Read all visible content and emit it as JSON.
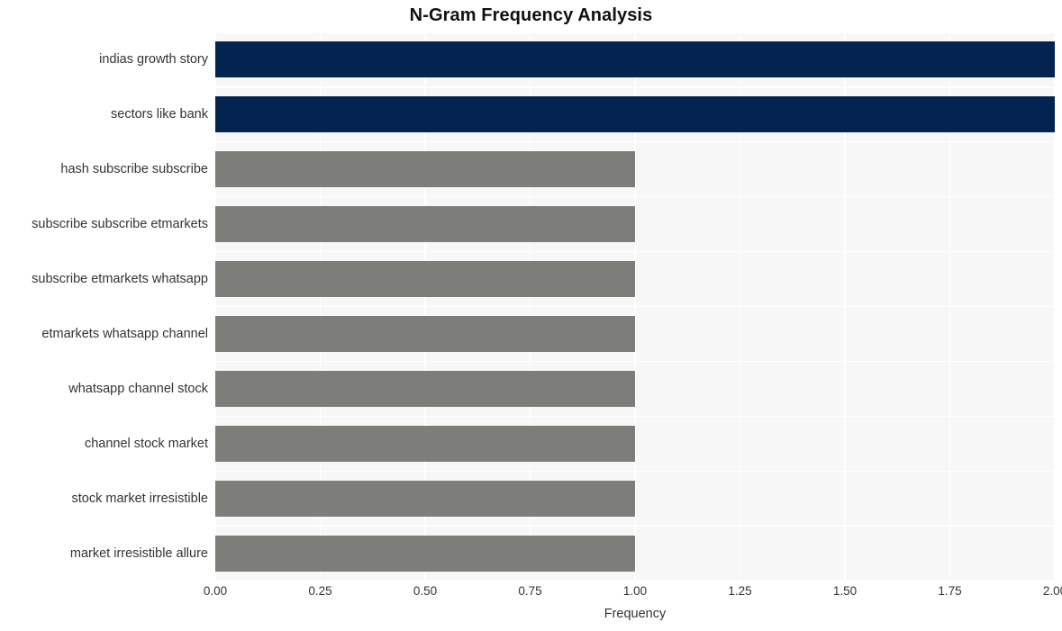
{
  "chart_data": {
    "type": "bar",
    "orientation": "horizontal",
    "title": "N-Gram Frequency Analysis",
    "xlabel": "Frequency",
    "ylabel": "",
    "xlim": [
      0,
      2
    ],
    "ylim": null,
    "grid": true,
    "legend": null,
    "categories": [
      "indias growth story",
      "sectors like bank",
      "hash subscribe subscribe",
      "subscribe subscribe etmarkets",
      "subscribe etmarkets whatsapp",
      "etmarkets whatsapp channel",
      "whatsapp channel stock",
      "channel stock market",
      "stock market irresistible",
      "market irresistible allure"
    ],
    "values": [
      2,
      2,
      1,
      1,
      1,
      1,
      1,
      1,
      1,
      1
    ],
    "bar_colors": [
      "#032450",
      "#032450",
      "#7d7d7a",
      "#7d7d7a",
      "#7d7d7a",
      "#7d7d7a",
      "#7d7d7a",
      "#7d7d7a",
      "#7d7d7a",
      "#7d7d7a"
    ],
    "xticks": [
      "0.00",
      "0.25",
      "0.50",
      "0.75",
      "1.00",
      "1.25",
      "1.50",
      "1.75",
      "2.00"
    ],
    "xtick_values": [
      0,
      0.25,
      0.5,
      0.75,
      1,
      1.25,
      1.5,
      1.75,
      2
    ],
    "colors": {
      "highlight": "#032450",
      "default": "#7d7d7a",
      "plot_background": "#f7f7f7",
      "grid": "#ffffff",
      "figure_background": "#ffffff",
      "text": "#333333",
      "title_text": "#111111"
    }
  }
}
